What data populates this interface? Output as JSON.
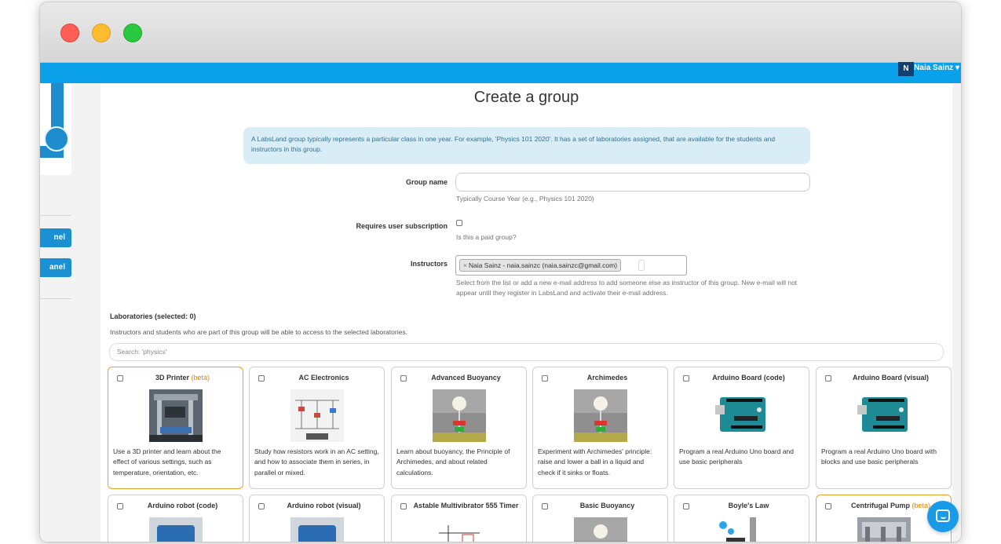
{
  "window": {
    "controls": [
      "close",
      "minimize",
      "maximize"
    ]
  },
  "header": {
    "user_initial": "N",
    "user_name": "Naia Sainz",
    "caret": "▾"
  },
  "sidebar": {
    "buttons": [
      {
        "label": "nel"
      },
      {
        "label": "anel"
      }
    ]
  },
  "page": {
    "title": "Create a group",
    "info": "A LabsLand group typically represents a particular class in one year. For example, 'Physics 101 2020'. It has a set of laboratories assigned, that are available for the students and instructors in this group."
  },
  "form": {
    "group_name": {
      "label": "Group name",
      "value": "",
      "help": "Typically Course Year (e.g., Physics 101 2020)"
    },
    "subscription": {
      "label": "Requires user subscription",
      "checked": false,
      "help": "Is this a paid group?"
    },
    "instructors": {
      "label": "Instructors",
      "tag": "Naia Sainz - naia.sainzc (naia.sainzc@gmail.com)",
      "tag_remove": "×",
      "help": "Select from the list or add a new e-mail address to add someone else as instructor of this group. New e-mail will not appear until they register in LabsLand and activate their e-mail address."
    }
  },
  "labs": {
    "title": "Laboratories (selected: 0)",
    "help": "Instructors and students who are part of this group will be able to access to the selected laboratories.",
    "search_placeholder": "Search: 'physics'",
    "beta_label": "(beta)",
    "items": [
      {
        "name": "3D Printer",
        "beta": true,
        "desc": "Use a 3D printer and learn about the effect of various settings, such as temperature, orientation, etc."
      },
      {
        "name": "AC Electronics",
        "beta": false,
        "desc": "Study how resistors work in an AC setting, and how to associate them in series, in parallel or mixed."
      },
      {
        "name": "Advanced Buoyancy",
        "beta": false,
        "desc": "Learn about buoyancy, the Principle of Archimedes, and about related calculations."
      },
      {
        "name": "Archimedes",
        "beta": false,
        "desc": "Experiment with Archimedes' principle: raise and lower a ball in a liquid and check if it sinks or floats."
      },
      {
        "name": "Arduino Board (code)",
        "beta": false,
        "desc": "Program a real Arduino Uno board and use basic peripherals"
      },
      {
        "name": "Arduino Board (visual)",
        "beta": false,
        "desc": "Program a real Arduino Uno board with blocks and use basic peripherals"
      },
      {
        "name": "Arduino robot (code)",
        "beta": false,
        "desc": ""
      },
      {
        "name": "Arduino robot (visual)",
        "beta": false,
        "desc": ""
      },
      {
        "name": "Astable Multivibrator 555 Timer",
        "beta": false,
        "desc": ""
      },
      {
        "name": "Basic Buoyancy",
        "beta": false,
        "desc": ""
      },
      {
        "name": "Boyle's Law",
        "beta": false,
        "desc": ""
      },
      {
        "name": "Centrifugal Pump",
        "beta": true,
        "desc": ""
      }
    ]
  },
  "colors": {
    "topbar": "#0aa0ea",
    "info_bg": "#d9edf7",
    "beta": "#e8850c"
  }
}
